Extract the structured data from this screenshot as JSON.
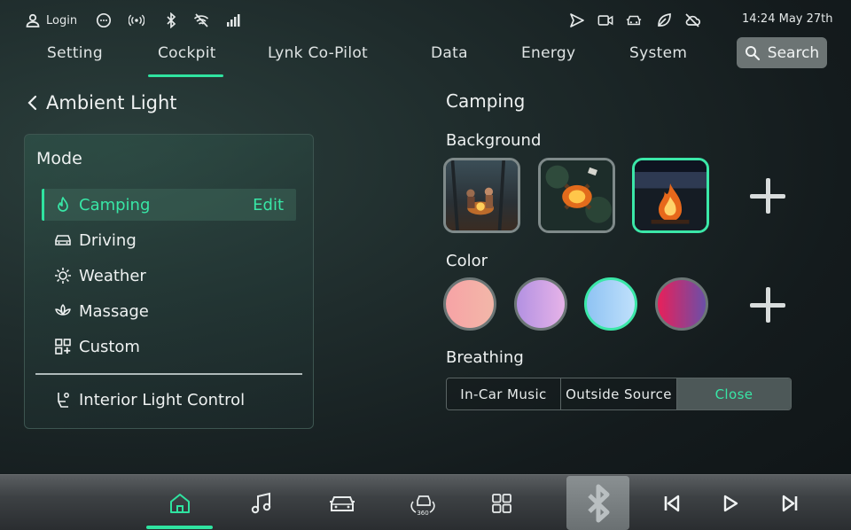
{
  "status_bar": {
    "login_label": "Login",
    "time_date": "14:24 May 27th",
    "left_icons": [
      "user-icon",
      "chat-icon",
      "broadcast-icon",
      "bluetooth-icon",
      "wifi-off-icon",
      "signal-icon"
    ],
    "right_icons": [
      "navigation-icon",
      "camera-icon",
      "car-icon",
      "leaf-icon",
      "cloud-off-icon"
    ]
  },
  "nav": {
    "tabs": [
      {
        "label": "Setting"
      },
      {
        "label": "Cockpit",
        "active": true
      },
      {
        "label": "Lynk Co-Pilot"
      },
      {
        "label": "Data"
      },
      {
        "label": "Energy"
      },
      {
        "label": "System"
      }
    ],
    "search_label": "Search",
    "accent": "#2fe3a0"
  },
  "page": {
    "title": "Ambient Light"
  },
  "mode": {
    "title": "Mode",
    "items": [
      {
        "label": "Camping",
        "icon": "flame-icon",
        "active": true
      },
      {
        "label": "Driving",
        "icon": "car-icon"
      },
      {
        "label": "Weather",
        "icon": "sun-icon"
      },
      {
        "label": "Massage",
        "icon": "lotus-icon"
      },
      {
        "label": "Custom",
        "icon": "grid-plus-icon"
      }
    ],
    "edit_label": "Edit",
    "interior_label": "Interior Light Control"
  },
  "detail": {
    "title": "Camping",
    "background_title": "Background",
    "backgrounds": [
      {
        "name": "campfire-group-photo"
      },
      {
        "name": "campfire-top-view-photo"
      },
      {
        "name": "campfire-lake-photo",
        "selected": true
      }
    ],
    "color_title": "Color",
    "colors": [
      {
        "from": "#f7a3a6",
        "to": "#f2b7a8",
        "selected": false
      },
      {
        "from": "#b391e2",
        "to": "#e6b3e8",
        "selected": false
      },
      {
        "from": "#8fc3f3",
        "to": "#bfe0fb",
        "selected": true
      },
      {
        "from": "#e8205a",
        "to": "#6b4fa8",
        "selected": false
      }
    ],
    "breathing_title": "Breathing",
    "breathing_options": [
      "In-Car Music",
      "Outside Source",
      "Close"
    ],
    "breathing_selected": "Close"
  },
  "dock": {
    "items": [
      "home-icon",
      "music-icon",
      "car-icon",
      "car-360-icon",
      "apps-grid-icon",
      "bluetooth-icon",
      "previous-track-icon",
      "play-icon",
      "next-track-icon"
    ],
    "badge_360": "360"
  }
}
